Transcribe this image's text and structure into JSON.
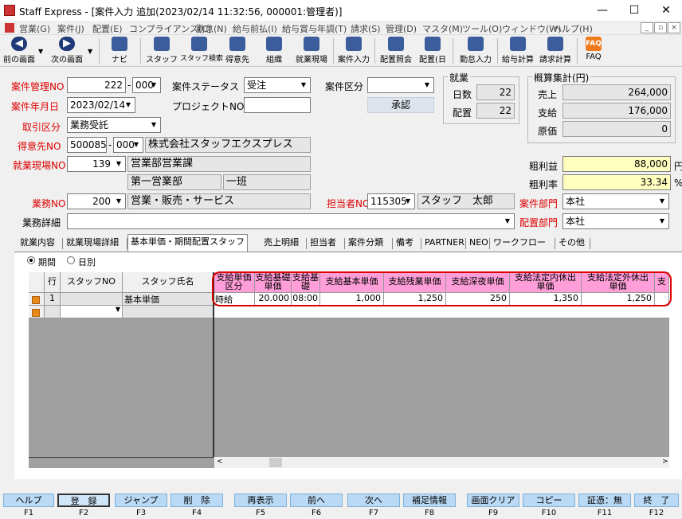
{
  "window": {
    "title": "Staff Express - [案件入力 追加(2023/02/14 11:32:56, 000001:管理者)]"
  },
  "menu": [
    "営業(G)",
    "案件(J)",
    "配置(E)",
    "コンプライアンス(C)",
    "勤怠(N)",
    "給与前払(I)",
    "給与賞与年調(T)",
    "請求(S)",
    "管理(D)",
    "マスタ(M)",
    "ツール(O)",
    "ウィンドウ(W)",
    "ヘルプ(H)"
  ],
  "toolbar": {
    "prev": "前の画面",
    "next": "次の画面",
    "navi": "ナビ",
    "staff": "スタッフ",
    "staff_search": "スタッフ検索",
    "client": "得意先",
    "org": "組織",
    "site": "就業現場",
    "case_input": "案件入力",
    "assign_view": "配置照会",
    "assign_day": "配置(日",
    "attendance": "勤怠入力",
    "payroll": "給与計算",
    "billing": "請求計算",
    "faq": "FAQ"
  },
  "form": {
    "case_no_label": "案件管理NO",
    "case_no": "222",
    "case_no_sep": "-",
    "case_sub": "000",
    "status_label": "案件ステータス",
    "status": "受注",
    "category_label": "案件区分",
    "category": "",
    "date_label": "案件年月日",
    "date": "2023/02/14",
    "project_label": "プロジェクトNO",
    "project": "",
    "approve": "承認",
    "trade_label": "取引区分",
    "trade": "業務受託",
    "client_label": "得意先NO",
    "client_no": "500085",
    "client_sep": "-",
    "client_sub": "000",
    "client_name": "株式会社スタッフエクスプレス",
    "site_label": "就業現場NO",
    "site_no": "139",
    "site_name": "営業部営業課",
    "site_dept": "第一営業部",
    "site_team": "一班",
    "job_label": "業務NO",
    "job_no": "200",
    "job_name": "営業・販売・サービス",
    "person_label": "担当者NO",
    "person_no": "115305",
    "person_name": "スタッフ　太郎",
    "dept_label": "案件部門",
    "dept": "本社",
    "detail_label": "業務詳細",
    "detail": "",
    "assign_dept_label": "配置部門",
    "assign_dept": "本社"
  },
  "work": {
    "title": "就業",
    "days_label": "日数",
    "days": "22",
    "placed_label": "配置",
    "placed": "22"
  },
  "estimate": {
    "title": "概算集計(円)",
    "sales_label": "売上",
    "sales": "264,000",
    "pay_label": "支給",
    "pay": "176,000",
    "cost_label": "原価",
    "cost": "0",
    "gross_label": "粗利益",
    "gross": "88,000",
    "gross_unit": "円",
    "rate_label": "粗利率",
    "rate": "33.34",
    "rate_unit": "%"
  },
  "tabs": [
    "就業内容",
    "就業現場詳細",
    "基本単価・期間配置スタッフ",
    "売上明細",
    "担当者",
    "案件分類",
    "備考",
    "PARTNER",
    "NEO",
    "ワークフロー",
    "その他"
  ],
  "radio": {
    "period": "期間",
    "daily": "日別"
  },
  "grid": {
    "headers": [
      "行",
      "スタッフNO",
      "スタッフ氏名"
    ],
    "pink_headers": [
      "支給単価区分",
      "支給基礎単価",
      "支給基礎",
      "支給基本単価",
      "支給残業単価",
      "支給深夜単価",
      "支給法定内休出単価",
      "支給法定外休出単価",
      "支"
    ],
    "row1": {
      "row": "1",
      "staff_no": "",
      "staff_name": "基本単価",
      "vals": [
        "時給",
        "20.000",
        "08:00",
        "1,000",
        "1,250",
        "250",
        "1,350",
        "1,250",
        ""
      ]
    }
  },
  "fkeys": [
    {
      "label": "ヘルプ",
      "key": "F1"
    },
    {
      "label": "登　録",
      "key": "F2"
    },
    {
      "label": "ジャンプ",
      "key": "F3"
    },
    {
      "label": "削　除",
      "key": "F4"
    },
    {
      "label": "再表示",
      "key": "F5"
    },
    {
      "label": "前へ",
      "key": "F6"
    },
    {
      "label": "次へ",
      "key": "F7"
    },
    {
      "label": "補足情報",
      "key": "F8"
    },
    {
      "label": "画面クリア",
      "key": "F9"
    },
    {
      "label": "コピー",
      "key": "F10"
    },
    {
      "label": "証憑：無",
      "key": "F11"
    },
    {
      "label": "終　了",
      "key": "F12"
    }
  ],
  "colors": {
    "red_label": "#dd0000",
    "pink": "#ff9ed8",
    "highlight": "#dd0000",
    "yellow": "#ffffc0",
    "fkey": "#b9d9f4"
  }
}
